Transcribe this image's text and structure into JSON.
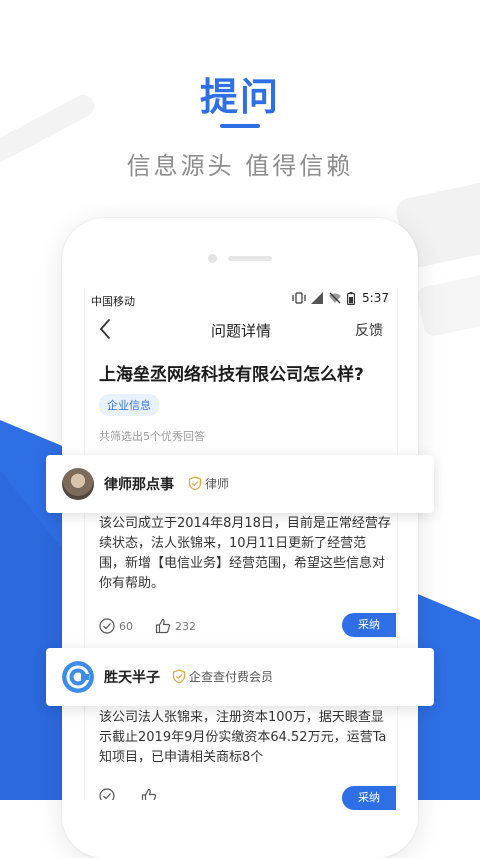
{
  "promo": {
    "title": "提问",
    "subtitle": "信息源头 值得信赖",
    "accent_color": "#2f6fe6"
  },
  "status_bar": {
    "carrier": "中国移动",
    "time": "5:37",
    "icons": [
      "vibrate-icon",
      "signal-icon",
      "wifi-off-icon",
      "battery-icon"
    ]
  },
  "nav": {
    "back_icon": "chevron-left-icon",
    "title": "问题详情",
    "feedback_label": "反馈"
  },
  "question": {
    "title": "上海垒丞网络科技有限公司怎么样?",
    "tag": "企业信息",
    "summary": "共筛选出5个优秀回答"
  },
  "answers": [
    {
      "author": "律师那点事",
      "badge": "律师",
      "badge_icon": "shield-check-icon",
      "content": "该公司成立于2014年8月18日，目前是正常经营存续状态，法人张锦来，10月11日更新了经营范围，新增【电信业务】经营范围，希望这些信息对你有帮助。",
      "agree_count": "60",
      "like_count": "232",
      "adopt_label": "采纳"
    },
    {
      "author": "胜天半子",
      "badge": "企查查付费会员",
      "badge_icon": "shield-check-icon",
      "content": "该公司法人张锦来，注册资本100万，据天眼查显示截止2019年9月份实缴资本64.52万元，运营Ta知项目，已申请相关商标8个",
      "agree_count": "",
      "like_count": "",
      "adopt_label": "采纳"
    }
  ]
}
